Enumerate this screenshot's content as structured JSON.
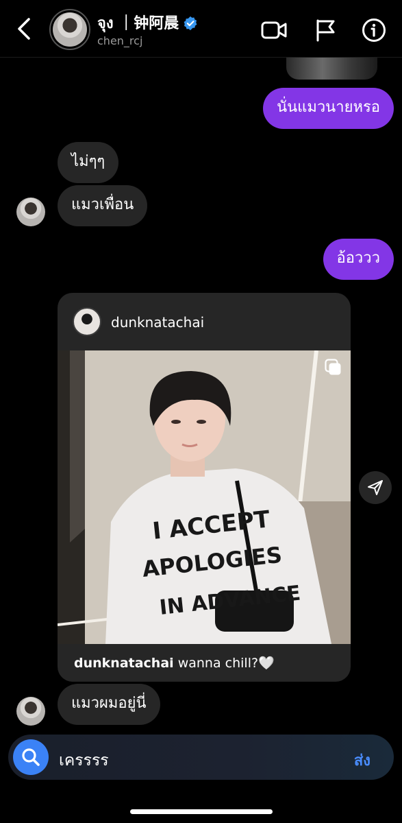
{
  "header": {
    "name": "จุง ｜钟阿晨",
    "handle": "chen_rcj",
    "icons": [
      "back-chevron-icon",
      "video-call-icon",
      "flag-icon",
      "info-icon"
    ]
  },
  "messages": [
    {
      "side": "sent",
      "text": "นั่นแมวนายหรอ"
    },
    {
      "side": "received",
      "text": "ไม่ๆๆ"
    },
    {
      "side": "received",
      "text": "แมวเพื่อน"
    },
    {
      "side": "sent",
      "text": "อ้อววว"
    },
    {
      "side": "received",
      "text": "แมวผมอยู่นี่"
    }
  ],
  "shared_post": {
    "username": "dunknatachai",
    "caption_user": "dunknatachai",
    "caption_text": " wanna chill?🤍",
    "shirt_text": "I ACCEPT APOLOGIES IN ADVANCE"
  },
  "composer": {
    "value": "เครรรร",
    "send_label": "ส่ง"
  },
  "colors": {
    "sent_bubble": "#8336e6",
    "received_bubble": "#262626",
    "accent_blue": "#3b82f6"
  }
}
